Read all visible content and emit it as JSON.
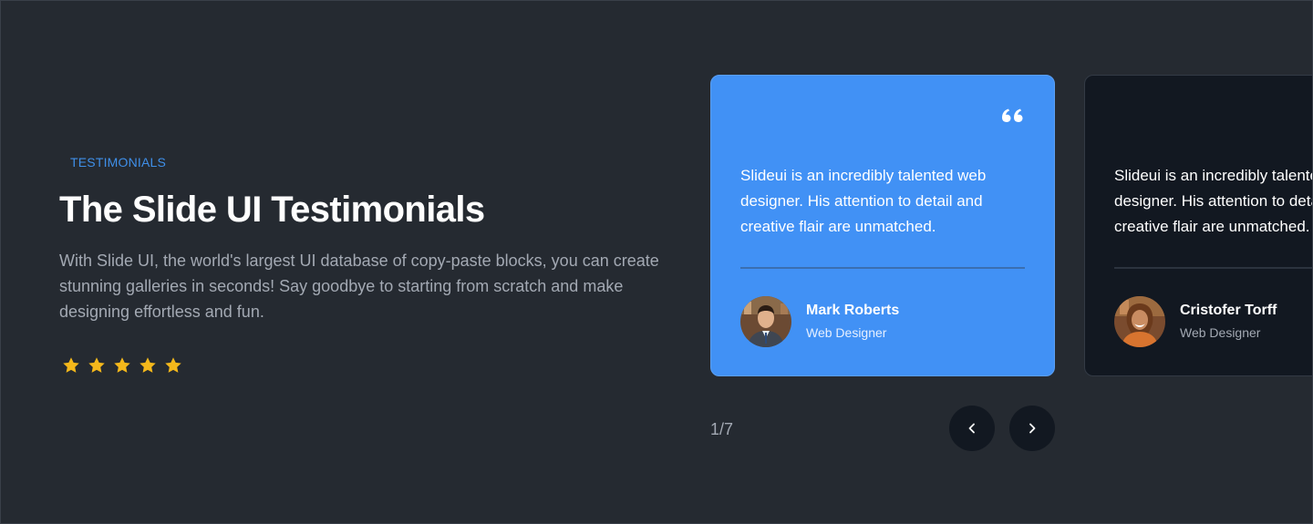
{
  "section": {
    "eyebrow": "TESTIMONIALS",
    "title": "The Slide UI Testimonials",
    "description": "With Slide UI, the world's largest UI database of copy-paste blocks, you can create stunning galleries in seconds! Say goodbye to starting from scratch and make designing effortless and fun.",
    "rating": {
      "value": 5,
      "max": 5,
      "icon": "star-icon"
    }
  },
  "testimonials": [
    {
      "quote": "Slideui is an incredibly talented web designer. His attention to detail and creative flair are unmatched.",
      "name": "Mark Roberts",
      "role": "Web Designer",
      "icon": "quote-icon"
    },
    {
      "quote": "Slideui is an incredibly talented web designer. His attention to detail and creative flair are unmatched.",
      "name": "Cristofer Torff",
      "role": "Web Designer"
    }
  ],
  "pager": {
    "counter": "1/7",
    "prev_icon": "chevron-left-icon",
    "next_icon": "chevron-right-icon"
  },
  "colors": {
    "background": "#252a31",
    "accent": "#4191f5",
    "card_dark": "#121821",
    "star": "#f5b81b",
    "muted_text": "#a3a9b3"
  }
}
